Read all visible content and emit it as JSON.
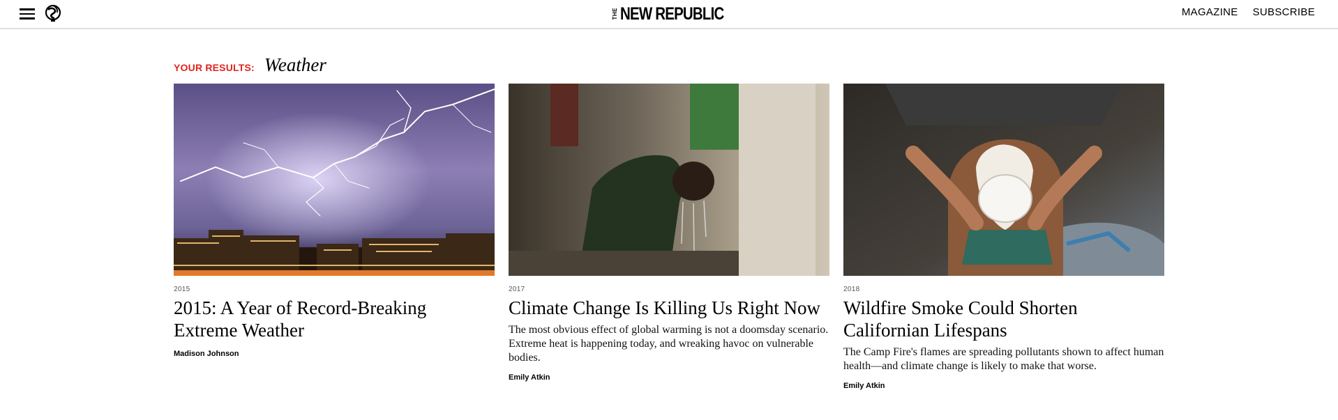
{
  "header": {
    "menu_icon": "hamburger-menu-icon",
    "logo_icon": "globe-logo-icon",
    "brand_small": "THE",
    "brand_name": "NEW REPUBLIC",
    "nav": {
      "magazine": "MAGAZINE",
      "subscribe": "SUBSCRIBE"
    }
  },
  "search": {
    "label": "YOUR RESULTS:",
    "query": "Weather"
  },
  "colors": {
    "accent_red": "#e0221e",
    "header_border": "#e0e0e0"
  },
  "results": [
    {
      "image": "lightning-storm-over-city-photo",
      "year": "2015",
      "title": "2015: A Year of Record-Breaking Extreme Weather",
      "dek": "",
      "author": "Madison Johnson"
    },
    {
      "image": "child-cooling-off-under-water-photo",
      "year": "2017",
      "title": "Climate Change Is Killing Us Right Now",
      "dek": "The most obvious effect of global warming is not a doomsday scenario. Extreme heat is happening today, and wreaking havoc on vulnerable bodies.",
      "author": "Emily Atkin"
    },
    {
      "image": "dog-wearing-respirator-mask-photo",
      "year": "2018",
      "title": "Wildfire Smoke Could Shorten Californian Lifespans",
      "dek": "The Camp Fire's flames are spreading pollutants shown to affect human health—and climate change is likely to make that worse.",
      "author": "Emily Atkin"
    }
  ]
}
